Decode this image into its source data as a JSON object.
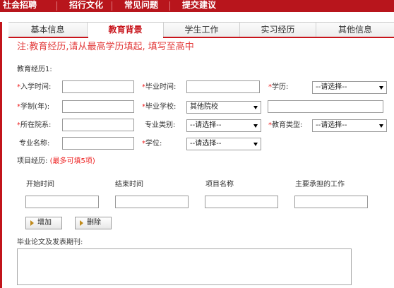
{
  "top_nav": {
    "items": [
      "社会招聘",
      "招行文化",
      "常见问题",
      "提交建议"
    ]
  },
  "tabs": {
    "items": [
      "基本信息",
      "教育背景",
      "学生工作",
      "实习经历",
      "其他信息"
    ],
    "active_index": 1
  },
  "notice": "注:教育经历,请从最高学历填起, 填写至高中",
  "education": {
    "section_title": "教育经历1:",
    "labels": {
      "enroll_time": "入学时间:",
      "grad_time": "毕业时间:",
      "degree_level": "学历:",
      "duration": "学制(年):",
      "grad_school": "毕业学校:",
      "department": "所在院系:",
      "major_category": "专业类别:",
      "edu_type": "教育类型:",
      "major_name": "专业名称:",
      "degree": "学位:"
    },
    "degree_level_value": "--请选择--",
    "grad_school_value": "其他院校",
    "major_category_value": "--请选择--",
    "edu_type_value": "--请选择--",
    "degree_value": "--请选择--"
  },
  "projects": {
    "title": "项目经历:",
    "hint": "(最多可填5项)",
    "columns": [
      "开始时间",
      "结束时间",
      "项目名称",
      "主要承担的工作"
    ],
    "add_label": "增加",
    "delete_label": "删除"
  },
  "thesis": {
    "label": "毕业论文及发表期刊:"
  },
  "colors": {
    "brand_red": "#b8151c",
    "notice_red": "#e23a3a"
  }
}
